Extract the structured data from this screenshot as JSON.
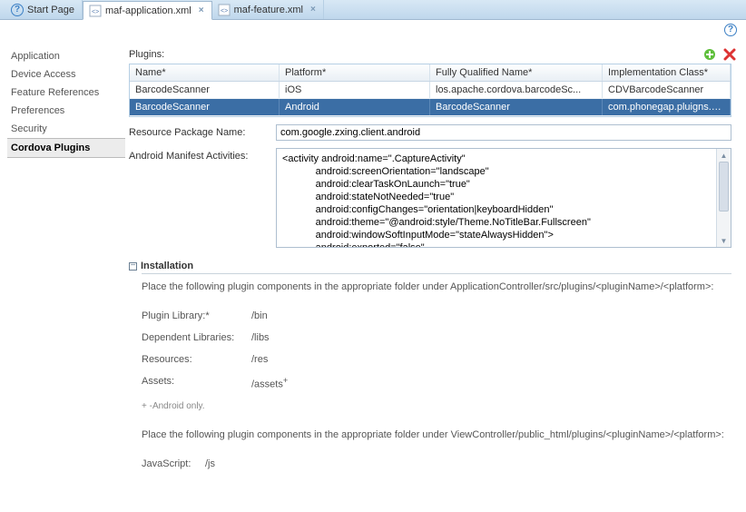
{
  "tabs": [
    {
      "label": "Start Page",
      "icon": "help"
    },
    {
      "label": "maf-application.xml",
      "icon": "xml",
      "active": true
    },
    {
      "label": "maf-feature.xml",
      "icon": "xml"
    }
  ],
  "sidebar": {
    "items": [
      {
        "label": "Application"
      },
      {
        "label": "Device Access"
      },
      {
        "label": "Feature References"
      },
      {
        "label": "Preferences"
      },
      {
        "label": "Security"
      },
      {
        "label": "Cordova Plugins",
        "selected": true
      }
    ]
  },
  "plugins": {
    "section_label": "Plugins:",
    "columns": [
      "Name*",
      "Platform*",
      "Fully Qualified Name*",
      "Implementation Class*"
    ],
    "rows": [
      {
        "name": "BarcodeScanner",
        "platform": "iOS",
        "fqn": "los.apache.cordova.barcodeSc...",
        "impl": "CDVBarcodeScanner"
      },
      {
        "name": "BarcodeScanner",
        "platform": "Android",
        "fqn": "BarcodeScanner",
        "impl": "com.phonegap.pluigns.barcode...",
        "selected": true
      }
    ]
  },
  "form": {
    "resource_pkg_label": "Resource Package Name:",
    "resource_pkg_value": "com.google.zxing.client.android",
    "manifest_label": "Android Manifest Activities:",
    "manifest_value": "<activity android:name=\".CaptureActivity\"\n            android:screenOrientation=\"landscape\"\n            android:clearTaskOnLaunch=\"true\"\n            android:stateNotNeeded=\"true\"\n            android:configChanges=\"orientation|keyboardHidden\"\n            android:theme=\"@android:style/Theme.NoTitleBar.Fullscreen\"\n            android:windowSoftInputMode=\"stateAlwaysHidden\">\n            android:exported=\"false\""
  },
  "installation": {
    "title": "Installation",
    "desc1": "Place the following plugin components in the appropriate folder under ApplicationController/src/plugins/<pluginName>/<platform>:",
    "rows": [
      {
        "k": "Plugin Library:*",
        "v": "/bin"
      },
      {
        "k": "Dependent Libraries:",
        "v": "/libs"
      },
      {
        "k": "Resources:",
        "v": "/res"
      },
      {
        "k": "Assets:",
        "v": "/assets"
      }
    ],
    "assets_sup": "+",
    "footnote": "+ -Android only.",
    "desc2": "Place the following plugin components in the appropriate folder under ViewController/public_html/plugins/<pluginName>/<platform>:",
    "js_row": {
      "k": "JavaScript:",
      "v": "/js"
    }
  }
}
